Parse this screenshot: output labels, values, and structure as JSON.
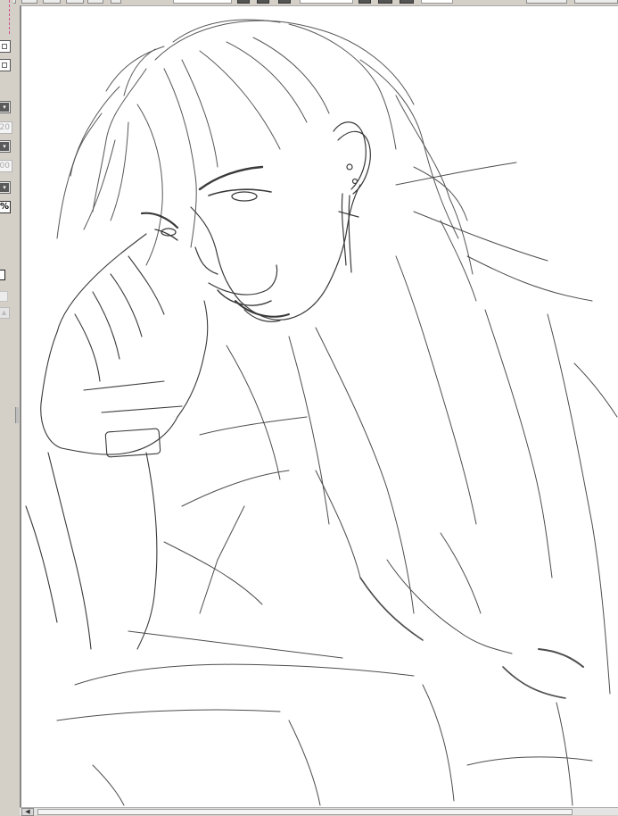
{
  "left_panel": {
    "value_1": "20",
    "value_2": "00",
    "percent_label": "%"
  },
  "icons": {
    "dropdown_arrow": "▾",
    "scroll_up_arrow": "▲",
    "scroll_left_arrow": "◀"
  },
  "colors": {
    "panel_bg": "#d4d0c8",
    "canvas_bg": "#ffffff",
    "sketch_stroke": "#3a3a3a",
    "accent_dash": "#d24b8c"
  }
}
